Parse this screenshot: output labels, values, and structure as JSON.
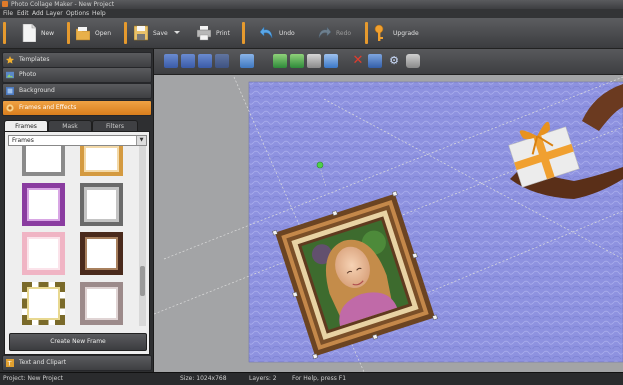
{
  "window": {
    "title": "Photo Collage Maker - New Project"
  },
  "menu": [
    "File",
    "Edit",
    "Add",
    "Layer",
    "Options",
    "Help"
  ],
  "toolbar": {
    "new": "New",
    "open": "Open",
    "save": "Save",
    "print": "Print",
    "undo": "Undo",
    "redo": "Redo",
    "upgrade": "Upgrade"
  },
  "sidebar": {
    "sections": [
      "Templates",
      "Photo",
      "Background",
      "Frames and Effects"
    ],
    "bottom_section": "Text and Clipart",
    "tabs": [
      "Frames",
      "Mask",
      "Filters"
    ],
    "category": "Frames",
    "create_button": "Create New Frame"
  },
  "status": {
    "project": "Project: New Project",
    "size": "Size: 1024x768",
    "layers": "Layers: 2",
    "help": "For Help, press F1"
  },
  "colors": {
    "accent": "#e69a2e",
    "canvas_background": "#8e92e0",
    "delete_icon": "#e03c2e"
  }
}
